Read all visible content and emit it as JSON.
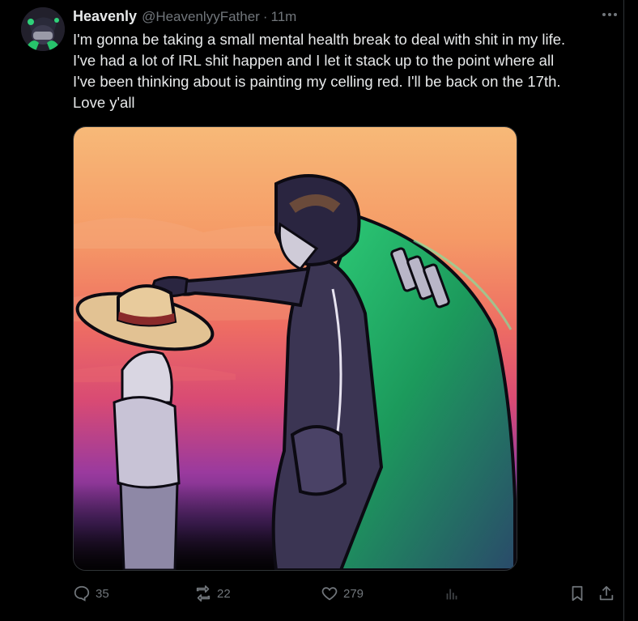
{
  "tweet": {
    "author": {
      "display_name": "Heavenly",
      "handle": "@HeavenlyyFather",
      "separator": "·",
      "time": "11m"
    },
    "text_lines": [
      "I'm gonna be taking a small mental health break to deal with shit in my life.",
      "I've had a lot of IRL shit happen and I let it stack up to the point where all",
      "I've been thinking about is painting my celling red.  I'll be back on the 17th.",
      "Love y'all"
    ],
    "media": {
      "description_icon": "illustration-image"
    },
    "actions": {
      "replies": "35",
      "reposts": "22",
      "likes": "279",
      "views": ""
    }
  },
  "colors": {
    "background": "#000000",
    "text_primary": "#e7e9ea",
    "text_secondary": "#71767b",
    "border": "#2f3336"
  },
  "icons": {
    "more": "more-dots-icon",
    "reply": "reply-bubble-icon",
    "repost": "repost-icon",
    "like": "heart-icon",
    "views": "views-bar-icon",
    "bookmark": "bookmark-icon",
    "share": "share-icon"
  }
}
